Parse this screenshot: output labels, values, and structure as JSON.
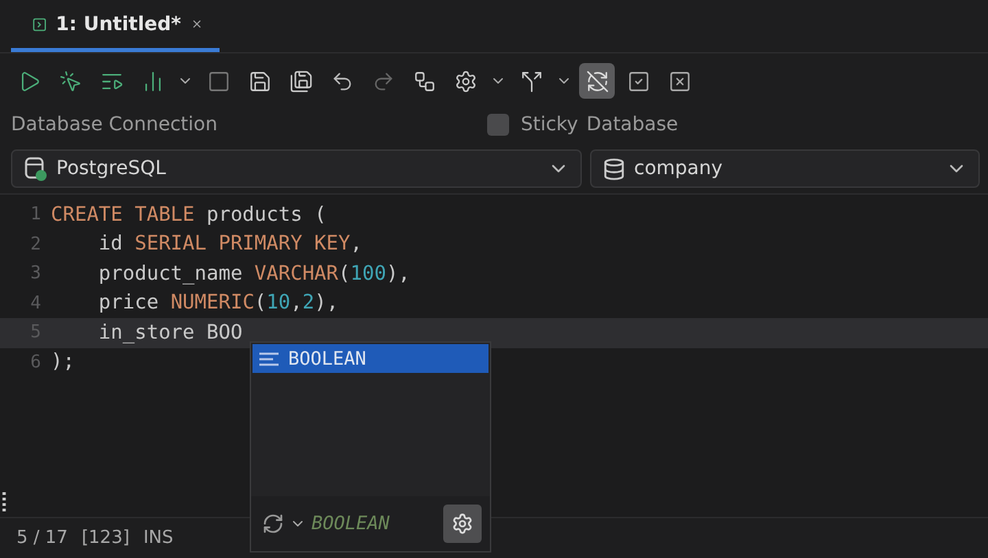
{
  "tabs": [
    {
      "label": "1: Untitled*",
      "selected": true
    }
  ],
  "toolbar": [
    {
      "kind": "play",
      "selected": false
    },
    {
      "kind": "play-cursor",
      "selected": false
    },
    {
      "kind": "play-list",
      "selected": false
    },
    {
      "kind": "play-chart",
      "selected": false
    },
    {
      "kind": "caret",
      "selected": false
    },
    {
      "kind": "stop",
      "selected": false
    },
    {
      "kind": "save",
      "selected": false
    },
    {
      "kind": "save-all",
      "selected": false
    },
    {
      "kind": "undo",
      "selected": false
    },
    {
      "kind": "redo",
      "selected": false
    },
    {
      "kind": "workflow",
      "selected": false
    },
    {
      "kind": "settings",
      "selected": false
    },
    {
      "kind": "caret",
      "selected": false
    },
    {
      "kind": "merge",
      "selected": false
    },
    {
      "kind": "caret",
      "selected": false
    },
    {
      "kind": "autocommit",
      "selected": true
    },
    {
      "kind": "commit",
      "selected": false
    },
    {
      "kind": "rollback",
      "selected": false
    }
  ],
  "connection": {
    "label": "Database Connection",
    "sticky": {
      "label": "Sticky",
      "checked": false
    },
    "database_label": "Database",
    "connection_value": "PostgreSQL",
    "database_value": "company"
  },
  "editor": {
    "lines": [
      {
        "number": "1",
        "current": false,
        "tokens": [
          {
            "text": "CREATE TABLE",
            "kind": "keyword"
          },
          {
            "text": " products (",
            "kind": "plain"
          }
        ]
      },
      {
        "number": "2",
        "current": false,
        "tokens": [
          {
            "text": "    id ",
            "kind": "plain"
          },
          {
            "text": "SERIAL PRIMARY KEY",
            "kind": "keyword"
          },
          {
            "text": ",",
            "kind": "plain"
          }
        ]
      },
      {
        "number": "3",
        "current": false,
        "tokens": [
          {
            "text": "    product_name ",
            "kind": "plain"
          },
          {
            "text": "VARCHAR",
            "kind": "keyword"
          },
          {
            "text": "(",
            "kind": "plain"
          },
          {
            "text": "100",
            "kind": "number"
          },
          {
            "text": "),",
            "kind": "plain"
          }
        ]
      },
      {
        "number": "4",
        "current": false,
        "tokens": [
          {
            "text": "    price ",
            "kind": "plain"
          },
          {
            "text": "NUMERIC",
            "kind": "keyword"
          },
          {
            "text": "(",
            "kind": "plain"
          },
          {
            "text": "10",
            "kind": "number"
          },
          {
            "text": ",",
            "kind": "plain"
          },
          {
            "text": "2",
            "kind": "number"
          },
          {
            "text": "),",
            "kind": "plain"
          }
        ]
      },
      {
        "number": "5",
        "current": true,
        "tokens": [
          {
            "text": "    in_store BOO",
            "kind": "plain"
          }
        ]
      },
      {
        "number": "6",
        "current": false,
        "tokens": [
          {
            "text": ");",
            "kind": "plain"
          }
        ]
      }
    ]
  },
  "autocomplete": {
    "items": [
      {
        "label": "BOOLEAN",
        "selected": true
      }
    ],
    "preview": "BOOLEAN"
  },
  "status_bar": {
    "position": "5 / 17",
    "encoding": "[123]",
    "mode": "INS"
  }
}
